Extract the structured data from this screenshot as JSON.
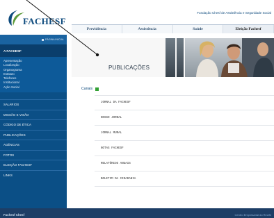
{
  "header": {
    "logo_text": "FACHESF",
    "org_name": "Fundação Chesf de Assistência e Seguridade Social"
  },
  "topnav": {
    "tabs": [
      {
        "label": "Previdência",
        "active": false
      },
      {
        "label": "Assistência",
        "active": false
      },
      {
        "label": "Saúde",
        "active": false
      },
      {
        "label": "Eleição Fachesf",
        "active": true
      }
    ]
  },
  "sidebar": {
    "top_link": "PÁGINA INICIAL",
    "header": "A FACHESF",
    "subitems": [
      "Apresentação",
      "Localização",
      "Organograma",
      "Estatuto",
      "Telefones",
      "Institucional",
      "Ação Social"
    ],
    "sections": [
      "SALÁRIOS",
      "MISSÃO E VISÃO",
      "CÓDIGO DE ÉTICA",
      "PUBLICAÇÕES",
      "AGÊNCIAS",
      "FOTOS",
      "ELEIÇÃO FACHESF",
      "LINKS"
    ]
  },
  "banner": {
    "title": "PUBLICAÇÕES"
  },
  "main": {
    "canais_label": "Canais",
    "publications": [
      "JORNAL DA FACHESF",
      "NOSSO JORNAL",
      "JORNAL MURAL",
      "NOTAS FACHESF",
      "RELATÓRIOS ANUAIS",
      "BOLETIM DA CIDADANIA"
    ]
  },
  "footer": {
    "logo_a": "Fachesf",
    "logo_b": "Chesf",
    "right_text": "Centro Empresarial do Recife"
  },
  "colors": {
    "sidebar_bg": "#0b4f86",
    "footer_bg": "#1d3e66",
    "accent_green": "#33a135",
    "brand_blue": "#0d4a7d"
  }
}
